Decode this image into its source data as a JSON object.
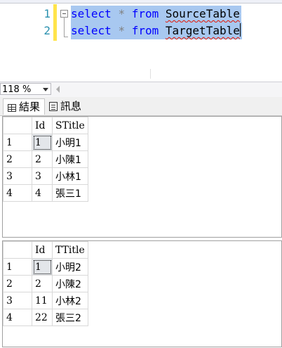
{
  "editor": {
    "lines": [
      {
        "num": "1",
        "kw1": "select",
        "star": "*",
        "kw2": "from",
        "table": "SourceTable"
      },
      {
        "num": "2",
        "kw1": "select",
        "star": "*",
        "kw2": "from",
        "table": "TargetTable"
      }
    ],
    "colors": {
      "keyword": "#0000ff",
      "selection": "#a8c8f0",
      "line_number": "#2b91af",
      "change_margin": "#ffe44b"
    }
  },
  "zoom": {
    "value": "118 %"
  },
  "result_tabs": {
    "results": "結果",
    "messages": "訊息"
  },
  "grid1": {
    "headers": [
      "",
      "Id",
      "STitle"
    ],
    "rows": [
      {
        "rn": "1",
        "id": "1",
        "title": "小明1"
      },
      {
        "rn": "2",
        "id": "2",
        "title": "小陳1"
      },
      {
        "rn": "3",
        "id": "3",
        "title": "小林1"
      },
      {
        "rn": "4",
        "id": "4",
        "title": "張三1"
      }
    ]
  },
  "grid2": {
    "headers": [
      "",
      "Id",
      "TTitle"
    ],
    "rows": [
      {
        "rn": "1",
        "id": "1",
        "title": "小明2"
      },
      {
        "rn": "2",
        "id": "2",
        "title": "小陳2"
      },
      {
        "rn": "3",
        "id": "11",
        "title": "小林2"
      },
      {
        "rn": "4",
        "id": "22",
        "title": "張三2"
      }
    ]
  }
}
